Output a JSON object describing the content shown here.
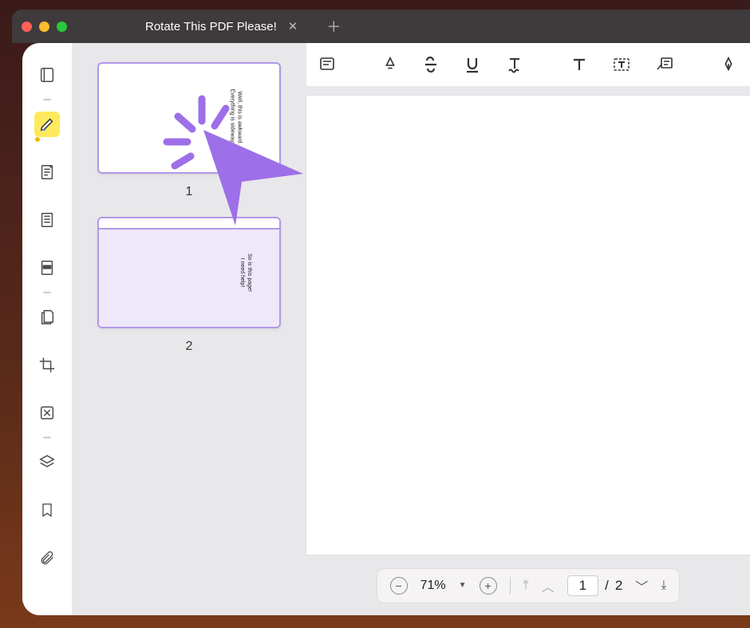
{
  "window": {
    "tab_title": "Rotate This PDF Please!",
    "traffic": {
      "close": "#ff5f57",
      "min": "#febc2e",
      "max": "#28c840"
    }
  },
  "rail": {
    "items": [
      {
        "name": "thumbnails-icon"
      },
      {
        "name": "highlight-icon",
        "active": true
      },
      {
        "name": "notes-icon"
      },
      {
        "name": "outline-icon"
      },
      {
        "name": "redact-icon"
      },
      {
        "name": "pages-icon"
      },
      {
        "name": "crop-icon"
      },
      {
        "name": "compare-icon"
      },
      {
        "name": "layers-icon"
      },
      {
        "name": "bookmark-icon"
      },
      {
        "name": "attachment-icon"
      }
    ]
  },
  "thumbs": {
    "page1_label": "1",
    "page1_text": "Well, this is awkward.\nEverything is sideways.",
    "page2_label": "2",
    "page2_text": "So is this page!\nI need help!"
  },
  "toolbar": {
    "items": [
      "annotate-icon",
      "highlighter-icon",
      "strikethrough-icon",
      "underline-icon",
      "squiggly-icon",
      "text-icon",
      "textbox-icon",
      "callout-icon",
      "pen-icon",
      "eraser-icon"
    ]
  },
  "bottombar": {
    "zoom_pct": "71%",
    "current_page": "1",
    "sep": "/",
    "total_pages": "2"
  },
  "cursor_color": "#9d6fe8"
}
